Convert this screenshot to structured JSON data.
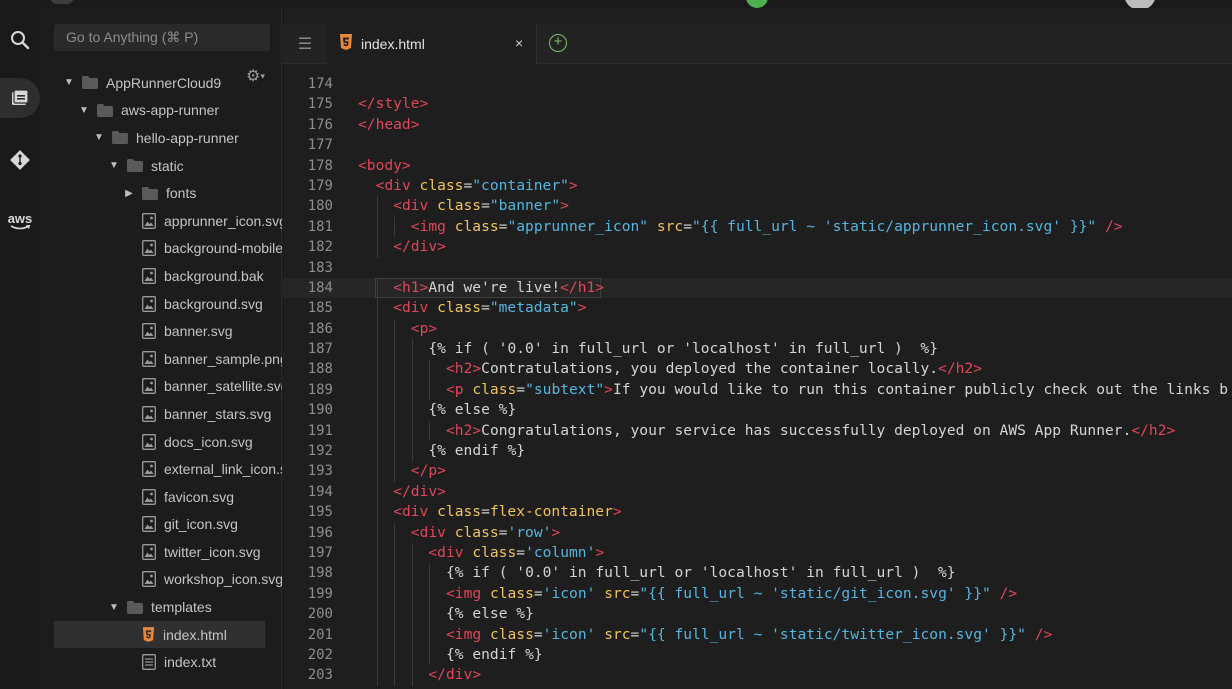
{
  "colors": {
    "tag": "#e0465a",
    "attribute": "#f0c35d",
    "string": "#56b6e0",
    "text": "#d4d4d4",
    "line_number": "#8e8e8e",
    "folder": "#5a5a5a",
    "html_file_icon": "#e8883a",
    "new_tab": "#7cbf6b"
  },
  "activity_bar": {
    "items": [
      {
        "name": "search",
        "icon": "search-icon"
      },
      {
        "name": "explorer",
        "icon": "files-icon",
        "active": true
      },
      {
        "name": "source-control",
        "icon": "git-icon"
      },
      {
        "name": "aws",
        "icon": "aws-icon",
        "label": "aws"
      }
    ]
  },
  "sidebar": {
    "goto_placeholder": "Go to Anything (⌘ P)",
    "tree": [
      {
        "label": "AppRunnerCloud9",
        "type": "folder",
        "depth": 0,
        "expanded": true
      },
      {
        "label": "aws-app-runner",
        "type": "folder",
        "depth": 1,
        "expanded": true
      },
      {
        "label": "hello-app-runner",
        "type": "folder",
        "depth": 2,
        "expanded": true
      },
      {
        "label": "static",
        "type": "folder",
        "depth": 3,
        "expanded": true
      },
      {
        "label": "fonts",
        "type": "folder",
        "depth": 4,
        "expanded": false
      },
      {
        "label": "apprunner_icon.svg",
        "type": "image",
        "depth": 4
      },
      {
        "label": "background-mobile.svg",
        "type": "image",
        "depth": 4
      },
      {
        "label": "background.bak",
        "type": "image",
        "depth": 4
      },
      {
        "label": "background.svg",
        "type": "image",
        "depth": 4
      },
      {
        "label": "banner.svg",
        "type": "image",
        "depth": 4
      },
      {
        "label": "banner_sample.png",
        "type": "image",
        "depth": 4
      },
      {
        "label": "banner_satellite.svg",
        "type": "image",
        "depth": 4
      },
      {
        "label": "banner_stars.svg",
        "type": "image",
        "depth": 4
      },
      {
        "label": "docs_icon.svg",
        "type": "image",
        "depth": 4
      },
      {
        "label": "external_link_icon.svg",
        "type": "image",
        "depth": 4
      },
      {
        "label": "favicon.svg",
        "type": "image",
        "depth": 4
      },
      {
        "label": "git_icon.svg",
        "type": "image",
        "depth": 4
      },
      {
        "label": "twitter_icon.svg",
        "type": "image",
        "depth": 4
      },
      {
        "label": "workshop_icon.svg",
        "type": "image",
        "depth": 4
      },
      {
        "label": "templates",
        "type": "folder",
        "depth": 3,
        "expanded": true
      },
      {
        "label": "index.html",
        "type": "html",
        "depth": 4,
        "selected": true
      },
      {
        "label": "index.txt",
        "type": "text",
        "depth": 4
      }
    ]
  },
  "editor": {
    "tab": {
      "label": "index.html",
      "close": "×"
    },
    "current_line": 184,
    "lines": [
      {
        "n": "174",
        "indent": 0,
        "tokens": []
      },
      {
        "n": "175",
        "indent": 0,
        "tokens": [
          [
            "t",
            "</style>"
          ]
        ]
      },
      {
        "n": "176",
        "indent": 0,
        "tokens": [
          [
            "t",
            "</head>"
          ]
        ]
      },
      {
        "n": "177",
        "indent": 0,
        "tokens": []
      },
      {
        "n": "178",
        "indent": 0,
        "tokens": [
          [
            "t",
            "<body>"
          ]
        ]
      },
      {
        "n": "179",
        "indent": 1,
        "tokens": [
          [
            "t",
            "<div "
          ],
          [
            "a",
            "class"
          ],
          [
            "x",
            "="
          ],
          [
            "s",
            "\"container\""
          ],
          [
            "t",
            ">"
          ]
        ]
      },
      {
        "n": "180",
        "indent": 2,
        "tokens": [
          [
            "t",
            "<div "
          ],
          [
            "a",
            "class"
          ],
          [
            "x",
            "="
          ],
          [
            "s",
            "\"banner\""
          ],
          [
            "t",
            ">"
          ]
        ]
      },
      {
        "n": "181",
        "indent": 3,
        "tokens": [
          [
            "t",
            "<img "
          ],
          [
            "a",
            "class"
          ],
          [
            "x",
            "="
          ],
          [
            "s",
            "\"apprunner_icon\""
          ],
          [
            "x",
            " "
          ],
          [
            "a",
            "src"
          ],
          [
            "x",
            "="
          ],
          [
            "s",
            "\"{{ full_url ~ 'static/apprunner_icon.svg' }}\""
          ],
          [
            "x",
            " "
          ],
          [
            "t",
            "/>"
          ]
        ]
      },
      {
        "n": "182",
        "indent": 2,
        "tokens": [
          [
            "t",
            "</div>"
          ]
        ]
      },
      {
        "n": "183",
        "indent": 0,
        "tokens": []
      },
      {
        "n": "184",
        "indent": 2,
        "tokens": [
          [
            "t",
            "<h1>"
          ],
          [
            "x",
            "And we're live!"
          ],
          [
            "t",
            "</h1>"
          ]
        ]
      },
      {
        "n": "185",
        "indent": 2,
        "tokens": [
          [
            "t",
            "<div "
          ],
          [
            "a",
            "class"
          ],
          [
            "x",
            "="
          ],
          [
            "s",
            "\"metadata\""
          ],
          [
            "t",
            ">"
          ]
        ]
      },
      {
        "n": "186",
        "indent": 3,
        "tokens": [
          [
            "t",
            "<p>"
          ]
        ]
      },
      {
        "n": "187",
        "indent": 4,
        "tokens": [
          [
            "x",
            "{% if ( '0.0' in full_url or 'localhost' in full_url )  %}"
          ]
        ]
      },
      {
        "n": "188",
        "indent": 5,
        "tokens": [
          [
            "t",
            "<h2>"
          ],
          [
            "x",
            "Contratulations, you deployed the container locally."
          ],
          [
            "t",
            "</h2>"
          ]
        ]
      },
      {
        "n": "189",
        "indent": 5,
        "tokens": [
          [
            "t",
            "<p "
          ],
          [
            "a",
            "class"
          ],
          [
            "x",
            "="
          ],
          [
            "s",
            "\"subtext\""
          ],
          [
            "t",
            ">"
          ],
          [
            "x",
            "If you would like to run this container publicly check out the links b"
          ]
        ]
      },
      {
        "n": "190",
        "indent": 4,
        "tokens": [
          [
            "x",
            "{% else %}"
          ]
        ]
      },
      {
        "n": "191",
        "indent": 5,
        "tokens": [
          [
            "t",
            "<h2>"
          ],
          [
            "x",
            "Congratulations, your service has successfully deployed on AWS App Runner."
          ],
          [
            "t",
            "</h2>"
          ]
        ]
      },
      {
        "n": "192",
        "indent": 4,
        "tokens": [
          [
            "x",
            "{% endif %}"
          ]
        ]
      },
      {
        "n": "193",
        "indent": 3,
        "tokens": [
          [
            "t",
            "</p>"
          ]
        ]
      },
      {
        "n": "194",
        "indent": 2,
        "tokens": [
          [
            "t",
            "</div>"
          ]
        ]
      },
      {
        "n": "195",
        "indent": 2,
        "tokens": [
          [
            "t",
            "<div "
          ],
          [
            "a",
            "class"
          ],
          [
            "x",
            "="
          ],
          [
            "a",
            "flex-container"
          ],
          [
            "t",
            ">"
          ]
        ]
      },
      {
        "n": "196",
        "indent": 3,
        "tokens": [
          [
            "t",
            "<div "
          ],
          [
            "a",
            "class"
          ],
          [
            "x",
            "="
          ],
          [
            "s",
            "'row'"
          ],
          [
            "t",
            ">"
          ]
        ]
      },
      {
        "n": "197",
        "indent": 4,
        "tokens": [
          [
            "t",
            "<div "
          ],
          [
            "a",
            "class"
          ],
          [
            "x",
            "="
          ],
          [
            "s",
            "'column'"
          ],
          [
            "t",
            ">"
          ]
        ]
      },
      {
        "n": "198",
        "indent": 5,
        "tokens": [
          [
            "x",
            "{% if ( '0.0' in full_url or 'localhost' in full_url )  %}"
          ]
        ]
      },
      {
        "n": "199",
        "indent": 5,
        "tokens": [
          [
            "t",
            "<img "
          ],
          [
            "a",
            "class"
          ],
          [
            "x",
            "="
          ],
          [
            "s",
            "'icon'"
          ],
          [
            "x",
            " "
          ],
          [
            "a",
            "src"
          ],
          [
            "x",
            "="
          ],
          [
            "s",
            "\"{{ full_url ~ 'static/git_icon.svg' }}\""
          ],
          [
            "x",
            " "
          ],
          [
            "t",
            "/>"
          ]
        ]
      },
      {
        "n": "200",
        "indent": 5,
        "tokens": [
          [
            "x",
            "{% else %}"
          ]
        ]
      },
      {
        "n": "201",
        "indent": 5,
        "tokens": [
          [
            "t",
            "<img "
          ],
          [
            "a",
            "class"
          ],
          [
            "x",
            "="
          ],
          [
            "s",
            "'icon'"
          ],
          [
            "x",
            " "
          ],
          [
            "a",
            "src"
          ],
          [
            "x",
            "="
          ],
          [
            "s",
            "\"{{ full_url ~ 'static/twitter_icon.svg' }}\""
          ],
          [
            "x",
            " "
          ],
          [
            "t",
            "/>"
          ]
        ]
      },
      {
        "n": "202",
        "indent": 5,
        "tokens": [
          [
            "x",
            "{% endif %}"
          ]
        ]
      },
      {
        "n": "203",
        "indent": 4,
        "tokens": [
          [
            "t",
            "</div>"
          ]
        ]
      }
    ]
  }
}
